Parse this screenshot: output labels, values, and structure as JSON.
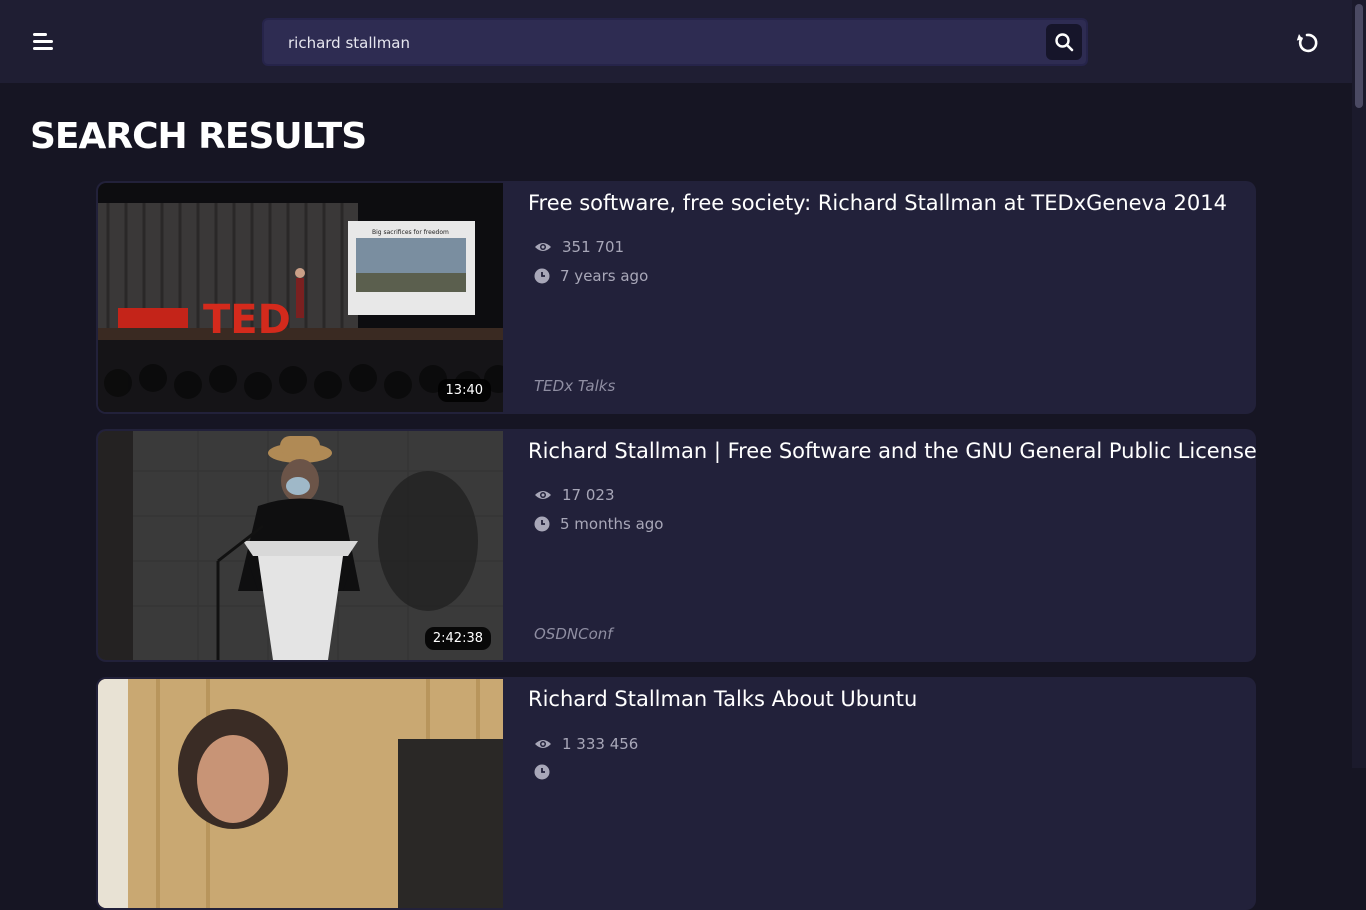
{
  "header": {
    "menu_icon": "hamburger-menu-icon",
    "search": {
      "value": "richard stallman"
    },
    "search_icon": "search-icon",
    "refresh_icon": "refresh-icon"
  },
  "page_title": "SEARCH RESULTS",
  "results": [
    {
      "title": "Free software, free society: Richard Stallman at TEDxGeneva 2014",
      "views": "351 701",
      "age": "7 years ago",
      "channel": "TEDx Talks",
      "duration": "13:40",
      "slide_text": "Big sacrifices for freedom"
    },
    {
      "title": "Richard Stallman | Free Software and the GNU General Public License",
      "views": "17 023",
      "age": "5 months ago",
      "channel": "OSDNConf",
      "duration": "2:42:38"
    },
    {
      "title": "Richard Stallman Talks About Ubuntu",
      "views": "1 333 456"
    }
  ],
  "colors": {
    "background": "#161523",
    "topbar": "#1f1e33",
    "card": "#22213a",
    "search_field": "#2e2c52"
  }
}
